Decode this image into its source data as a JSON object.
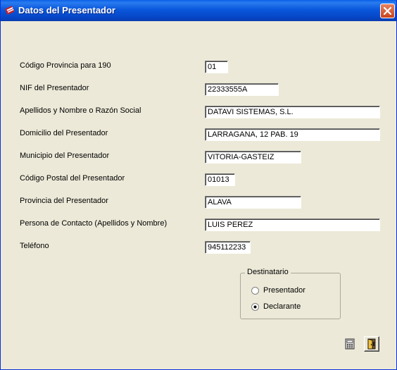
{
  "window": {
    "title": "Datos del Presentador"
  },
  "fields": [
    {
      "label": "Código Provincia para 190",
      "value": "01"
    },
    {
      "label": "NIF del Presentador",
      "value": "22333555A"
    },
    {
      "label": "Apellidos y Nombre o Razón Social",
      "value": "DATAVI SISTEMAS, S.L."
    },
    {
      "label": "Domicilio del Presentador",
      "value": "LARRAGANA, 12  PAB. 19"
    },
    {
      "label": "Municipio del Presentador",
      "value": "VITORIA-GASTEIZ"
    },
    {
      "label": "Código Postal del Presentador",
      "value": "01013"
    },
    {
      "label": "Provincia del Presentador",
      "value": "ALAVA"
    },
    {
      "label": "Persona de Contacto (Apellidos y Nombre)",
      "value": "LUIS PEREZ"
    },
    {
      "label": "Teléfono",
      "value": "945112233"
    }
  ],
  "destinatario": {
    "title": "Destinatario",
    "options": [
      {
        "label": "Presentador",
        "checked": false
      },
      {
        "label": "Declarante",
        "checked": true
      }
    ]
  },
  "toolbar": {
    "calculator_icon": "calculator-icon",
    "exit_icon": "exit-door-icon"
  }
}
